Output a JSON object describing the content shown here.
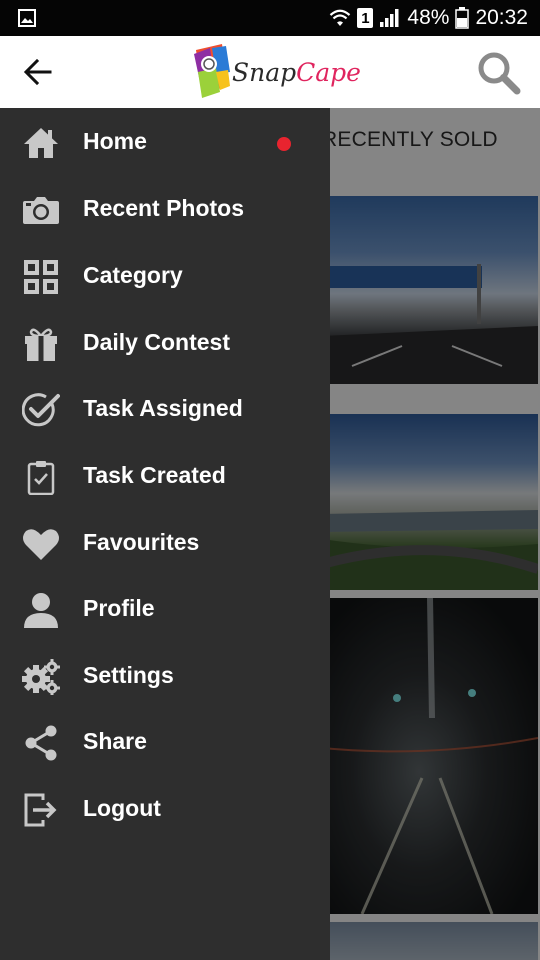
{
  "status_bar": {
    "battery": "48%",
    "time": "20:32",
    "sim": "1"
  },
  "app_bar": {
    "logo_part1": "Snap",
    "logo_part2": "Cape"
  },
  "content": {
    "tab_label": "RECENTLY SOLD"
  },
  "drawer": {
    "items": [
      {
        "label": "Home",
        "icon": "home-icon",
        "badge": true
      },
      {
        "label": "Recent Photos",
        "icon": "camera-icon"
      },
      {
        "label": "Category",
        "icon": "grid-icon"
      },
      {
        "label": "Daily Contest",
        "icon": "gift-icon"
      },
      {
        "label": "Task Assigned",
        "icon": "check-circle-icon"
      },
      {
        "label": "Task Created",
        "icon": "clipboard-check-icon"
      },
      {
        "label": "Favourites",
        "icon": "heart-icon"
      },
      {
        "label": "Profile",
        "icon": "person-icon"
      },
      {
        "label": "Settings",
        "icon": "gears-icon"
      },
      {
        "label": "Share",
        "icon": "share-icon"
      },
      {
        "label": "Logout",
        "icon": "logout-icon"
      }
    ]
  },
  "colors": {
    "drawer_bg": "#2e2e2e",
    "icon_gray": "#c8c8c8",
    "badge_red": "#e8242f",
    "logo_snap": "#2a2a2a",
    "logo_cape": "#e0245e"
  }
}
